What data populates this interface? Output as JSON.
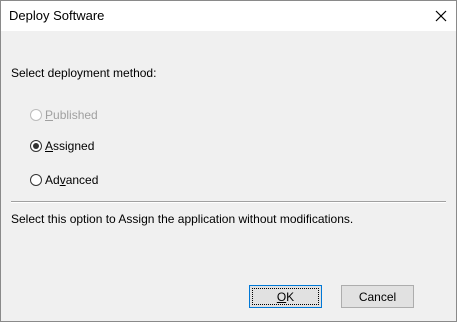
{
  "window": {
    "title": "Deploy Software",
    "close_icon": "close-icon"
  },
  "prompt": "Select deployment method:",
  "options": [
    {
      "label": "Published",
      "accel": "P",
      "rest": "ublished",
      "prefix": "",
      "checked": false,
      "disabled": true
    },
    {
      "label": "Assigned",
      "accel": "A",
      "rest": "ssigned",
      "prefix": "",
      "checked": true,
      "disabled": false
    },
    {
      "label": "Advanced",
      "accel": "v",
      "rest": "anced",
      "prefix": "Ad",
      "checked": false,
      "disabled": false
    }
  ],
  "description": "Select this option to Assign the application without modifications.",
  "buttons": {
    "ok": "OK",
    "ok_accel": "O",
    "ok_rest": "K",
    "cancel": "Cancel"
  },
  "colors": {
    "accent": "#0078d7",
    "disabled_text": "#a0a0a0",
    "dialog_bg": "#f0f0f0"
  }
}
